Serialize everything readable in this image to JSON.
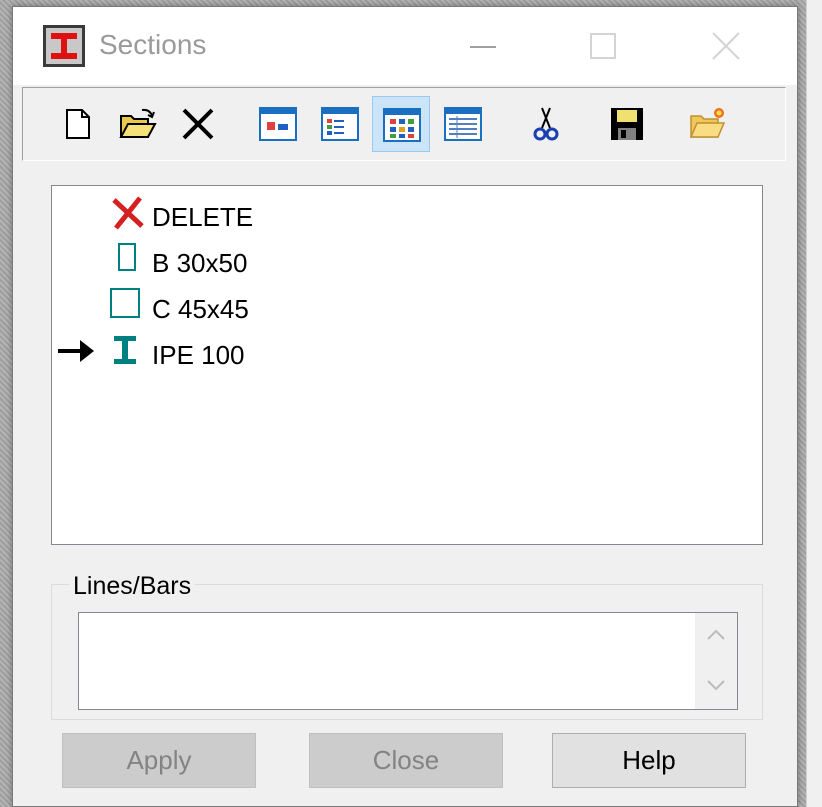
{
  "window": {
    "title": "Sections",
    "controls": [
      "minimize",
      "maximize",
      "close"
    ]
  },
  "toolbar": {
    "buttons": [
      {
        "name": "new-icon"
      },
      {
        "name": "open-folder-icon"
      },
      {
        "name": "delete-x-icon"
      },
      {
        "name": "view-mode-1-icon"
      },
      {
        "name": "view-mode-2-icon"
      },
      {
        "name": "view-mode-3-icon",
        "active": true
      },
      {
        "name": "view-mode-4-icon"
      },
      {
        "name": "cut-scissors-icon"
      },
      {
        "name": "save-disk-icon"
      },
      {
        "name": "folder-new-icon"
      }
    ]
  },
  "sections": {
    "items": [
      {
        "label": "DELETE",
        "icon": "delete-x-icon"
      },
      {
        "label": "B 30x50",
        "icon": "rectangle-section-icon"
      },
      {
        "label": "C 45x45",
        "icon": "square-section-icon"
      },
      {
        "label": "IPE 100",
        "icon": "i-beam-section-icon",
        "current": true
      }
    ]
  },
  "lines_bars": {
    "label": "Lines/Bars",
    "value": ""
  },
  "buttons": {
    "apply": "Apply",
    "close": "Close",
    "help": "Help"
  },
  "colors": {
    "accent": "#008080",
    "delete_red": "#d42020",
    "active_button": "#cce4f7"
  }
}
